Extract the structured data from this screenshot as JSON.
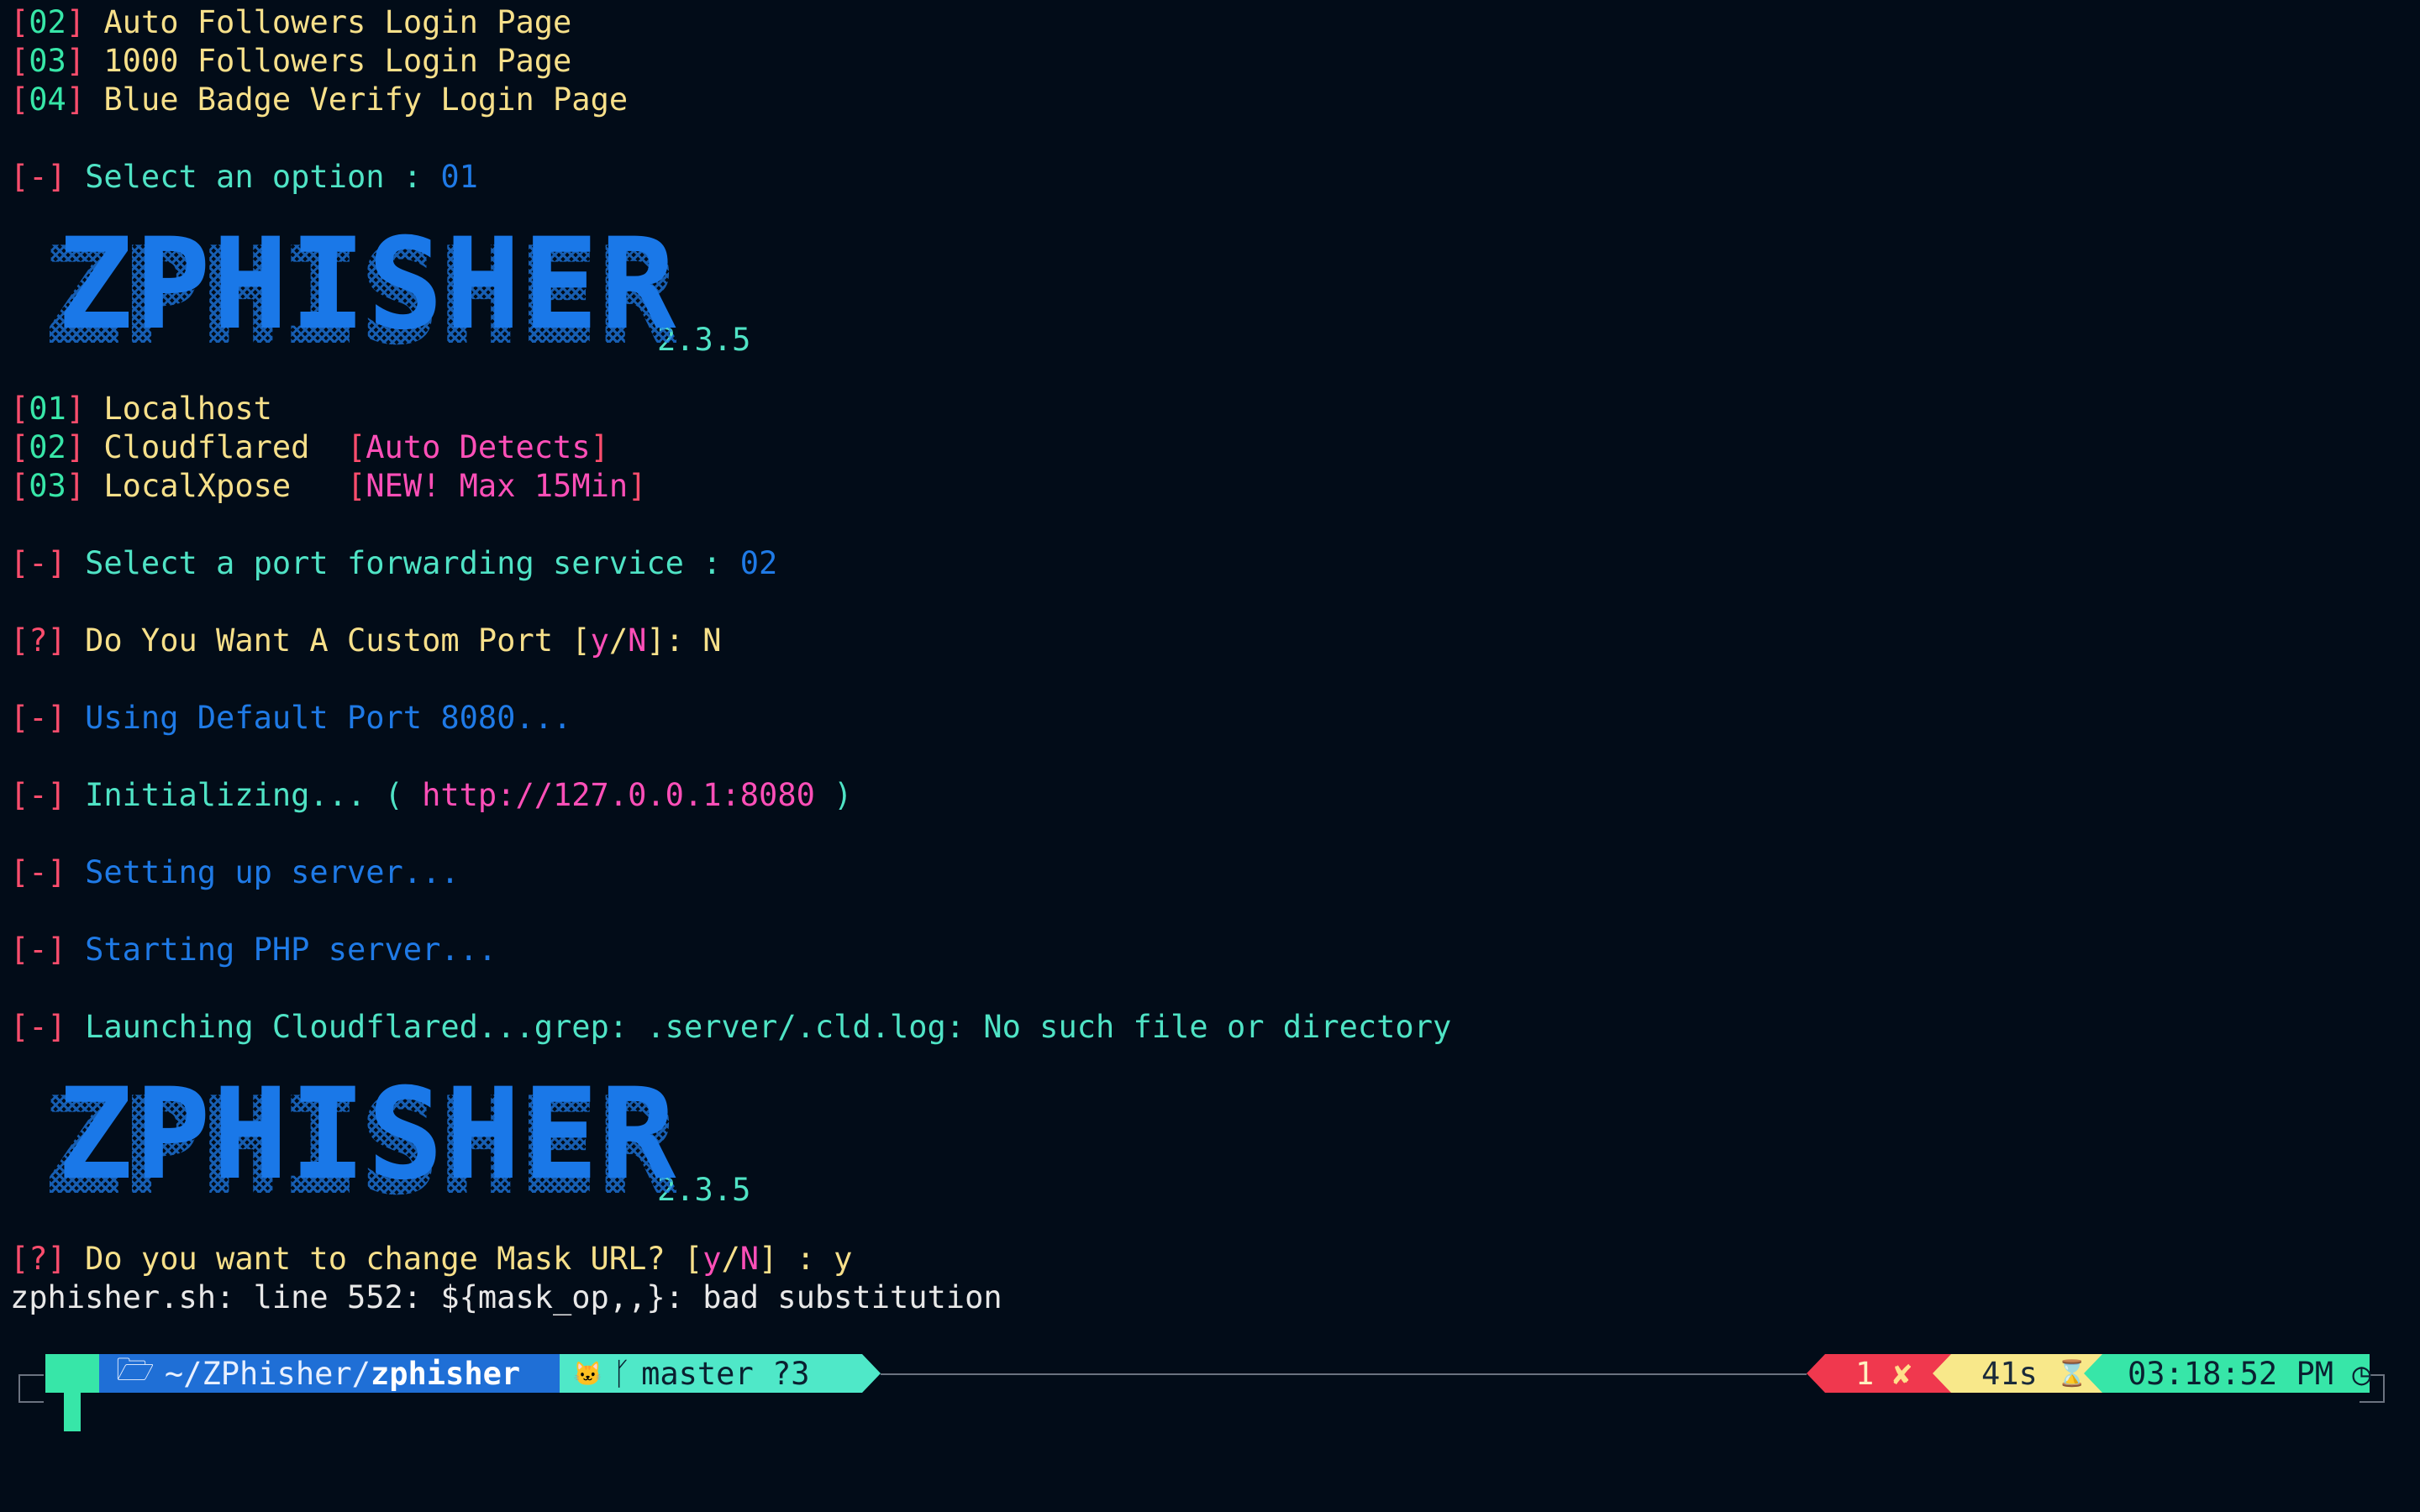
{
  "menu_top": [
    {
      "num": "02",
      "label": "Auto Followers Login Page"
    },
    {
      "num": "03",
      "label": "1000 Followers Login Page"
    },
    {
      "num": "04",
      "label": "Blue Badge Verify Login Page"
    }
  ],
  "select_option": {
    "marker": "[-]",
    "text": "Select an option : ",
    "value": "01"
  },
  "banner": {
    "logo_text": "ZPHISHER",
    "version": "2.3.5"
  },
  "port_menu": [
    {
      "num": "01",
      "label": "Localhost",
      "note": ""
    },
    {
      "num": "02",
      "label": "Cloudflared  ",
      "note": "Auto Detects"
    },
    {
      "num": "03",
      "label": "LocalXpose   ",
      "note": "NEW! Max 15Min"
    }
  ],
  "select_port": {
    "marker": "[-]",
    "text": "Select a port forwarding service : ",
    "value": "02"
  },
  "custom_port": {
    "marker": "[?]",
    "text": "Do You Want A Custom Port ",
    "y": "y",
    "N": "N",
    "answer": "]: N"
  },
  "default_port": {
    "marker": "[-]",
    "text": "Using Default Port 8080..."
  },
  "init": {
    "marker": "[-]",
    "text": "Initializing... ( ",
    "url": "http://127.0.0.1:8080",
    "close": " )"
  },
  "setup": {
    "marker": "[-]",
    "text": "Setting up server..."
  },
  "php": {
    "marker": "[-]",
    "text": "Starting PHP server..."
  },
  "launch": {
    "marker": "[-]",
    "text": "Launching Cloudflared...grep: .server/.cld.log: No such file or directory"
  },
  "mask": {
    "marker": "[?]",
    "text": "Do you want to change Mask URL? ",
    "y": "y",
    "N": "N",
    "answer": "] : y"
  },
  "error_line": "zphisher.sh: line 552: ${mask_op,,}: bad substitution",
  "prompt": {
    "apple_icon": "",
    "folder_icon": "🗁",
    "path_prefix": "~/ZPhisher/",
    "path_bold": "zphisher",
    "github_icon": "🐱",
    "branch_icon": "ᚴ",
    "branch": "master ?3",
    "exit_code": "1",
    "exit_icon": "✘",
    "duration": "41s",
    "hourglass_icon": "⌛",
    "clock": "03:18:52 PM",
    "clock_icon": "◷"
  },
  "colors": {
    "background": "#020c18",
    "red": "#ff4d6d",
    "green": "#37e6a8",
    "yellow": "#f7e08a",
    "blue": "#1f7ae6",
    "pink": "#ff4fb8"
  }
}
